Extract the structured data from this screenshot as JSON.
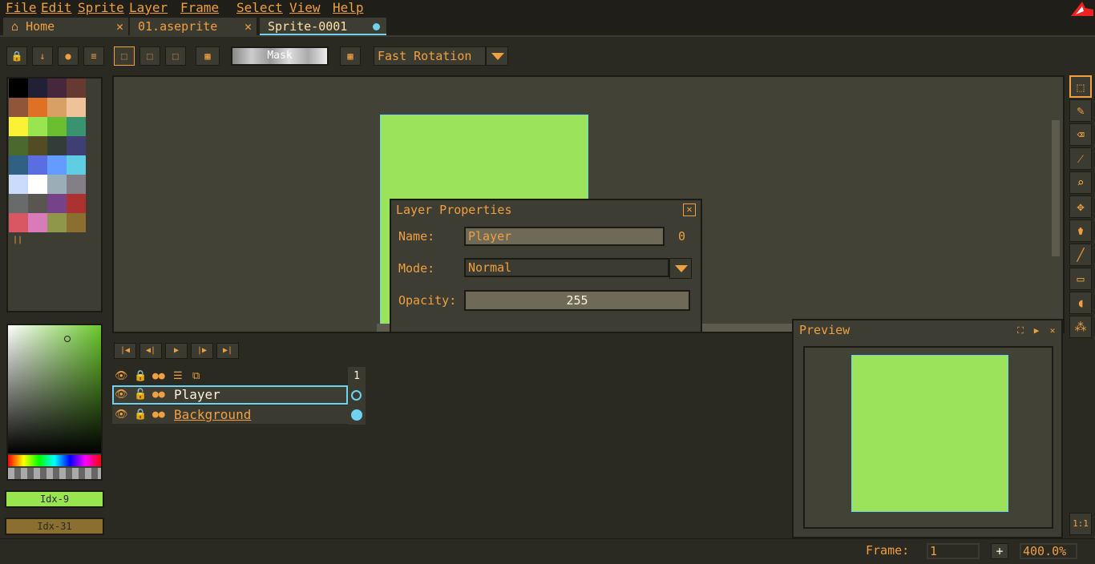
{
  "menu": [
    "File",
    "Edit",
    "Sprite",
    "Layer",
    "Frame",
    "Select",
    "View",
    "Help"
  ],
  "tabs": [
    {
      "label": "Home",
      "icon": "home-icon"
    },
    {
      "label": "01.aseprite"
    },
    {
      "label": "Sprite-0001"
    }
  ],
  "toolbar": {
    "mask_label": "Mask",
    "rotation": "Fast Rotation"
  },
  "palette": {
    "colors": [
      "#000000",
      "#222034",
      "#45283c",
      "#663931",
      "#8f563b",
      "#df7126",
      "#d9a066",
      "#eec39a",
      "#fbf236",
      "#99e550",
      "#6abe30",
      "#37946e",
      "#4b692f",
      "#524b24",
      "#323c39",
      "#3f3f74",
      "#306082",
      "#5b6ee1",
      "#639bff",
      "#5fcde4",
      "#cbdbfc",
      "#ffffff",
      "#9badb7",
      "#847e87",
      "#696a6a",
      "#595652",
      "#76428a",
      "#ac3232",
      "#d95763",
      "#d77bba",
      "#8f974a",
      "#8a6f30"
    ]
  },
  "colors": {
    "foreground": "Idx-9",
    "foreground_hex": "#99e550",
    "background": "Idx-31",
    "background_hex": "#8a6f30"
  },
  "dialog": {
    "title": "Layer Properties",
    "name_label": "Name:",
    "name_value": "Player",
    "user_data_btn": "0",
    "mode_label": "Mode:",
    "mode_value": "Normal",
    "opacity_label": "Opacity:",
    "opacity_value": "255"
  },
  "timeline": {
    "frame_header": "1",
    "layers": [
      {
        "name": "Player",
        "selected": true
      },
      {
        "name": "Background",
        "selected": false
      }
    ]
  },
  "preview": {
    "title": "Preview"
  },
  "status": {
    "frame_label": "Frame:",
    "frame_value": "1",
    "add_label": "+",
    "zoom": "400.0%"
  },
  "right_tools": [
    "marquee-tool-icon",
    "pencil-icon",
    "eraser-icon",
    "eyedropper-icon",
    "zoom-icon",
    "move-icon",
    "paint-bucket-icon",
    "line-icon",
    "rectangle-icon",
    "blur-icon",
    "spray-icon"
  ],
  "zoom_reset_label": "1:1"
}
